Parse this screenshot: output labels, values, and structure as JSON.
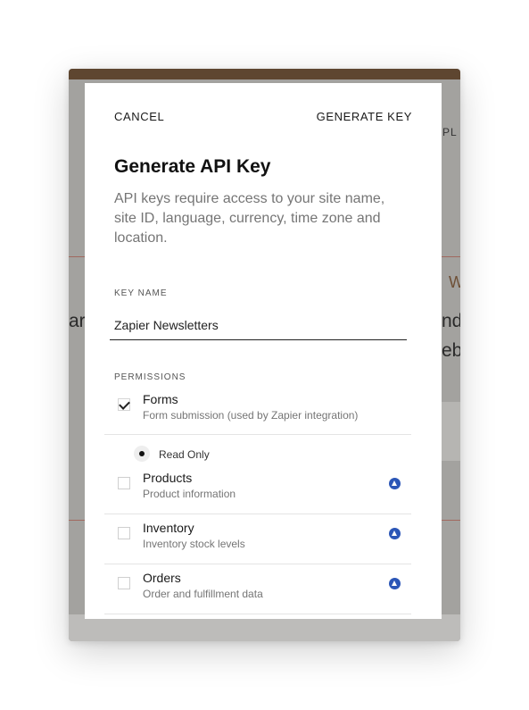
{
  "background": {
    "fragments": [
      "PL",
      "W",
      "ari",
      "nd",
      "ebs"
    ]
  },
  "modal": {
    "cancel_label": "CANCEL",
    "generate_label": "GENERATE KEY",
    "title": "Generate API Key",
    "description": "API keys require access to your site name, site ID, language, currency, time zone and location.",
    "key_name": {
      "label": "KEY NAME",
      "value": "Zapier Newsletters"
    },
    "permissions": {
      "label": "PERMISSIONS",
      "items": [
        {
          "title": "Forms",
          "subtitle": "Form submission (used by Zapier integration)",
          "checked": true
        },
        {
          "title": "Products",
          "subtitle": "Product information",
          "checked": false
        },
        {
          "title": "Inventory",
          "subtitle": "Inventory stock levels",
          "checked": false
        },
        {
          "title": "Orders",
          "subtitle": "Order and fulfillment data",
          "checked": false
        }
      ],
      "access_option": {
        "label": "Read Only",
        "selected": true
      }
    }
  },
  "colors": {
    "header_bar": "#5e4630",
    "overlay": "#a3a29f",
    "accent_rule": "#a0564a",
    "info_icon": "#2b56b7"
  },
  "icons": {
    "check": "checkmark-icon",
    "info": "upgrade-info-icon",
    "radio": "radio-selected-icon"
  }
}
